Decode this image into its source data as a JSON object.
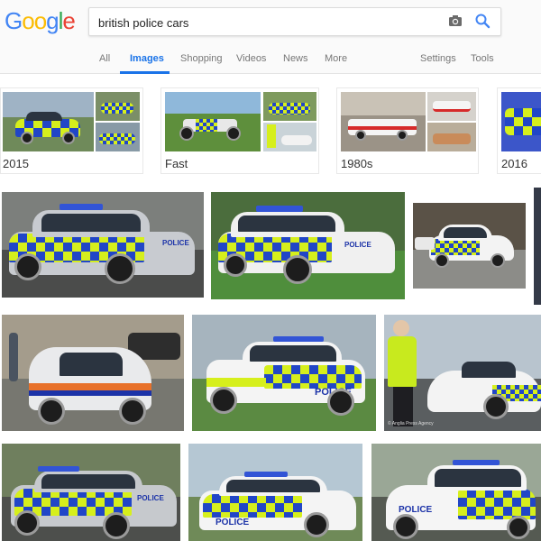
{
  "logo": {
    "letters": [
      "G",
      "o",
      "o",
      "g",
      "l",
      "e"
    ]
  },
  "search": {
    "query": "british police cars"
  },
  "tabs": {
    "all": "All",
    "images": "Images",
    "shopping": "Shopping",
    "videos": "Videos",
    "news": "News",
    "more": "More",
    "settings": "Settings",
    "tools": "Tools"
  },
  "related": [
    {
      "label": "2015"
    },
    {
      "label": "Fast"
    },
    {
      "label": "1980s"
    },
    {
      "label": "2016"
    }
  ],
  "results": {
    "r3c3_caption": "© Anglia Press Agency"
  },
  "colors": {
    "accent": "#1a73e8",
    "battenburg_blue": "#2146c7",
    "battenburg_yellow": "#d6ef1c"
  }
}
